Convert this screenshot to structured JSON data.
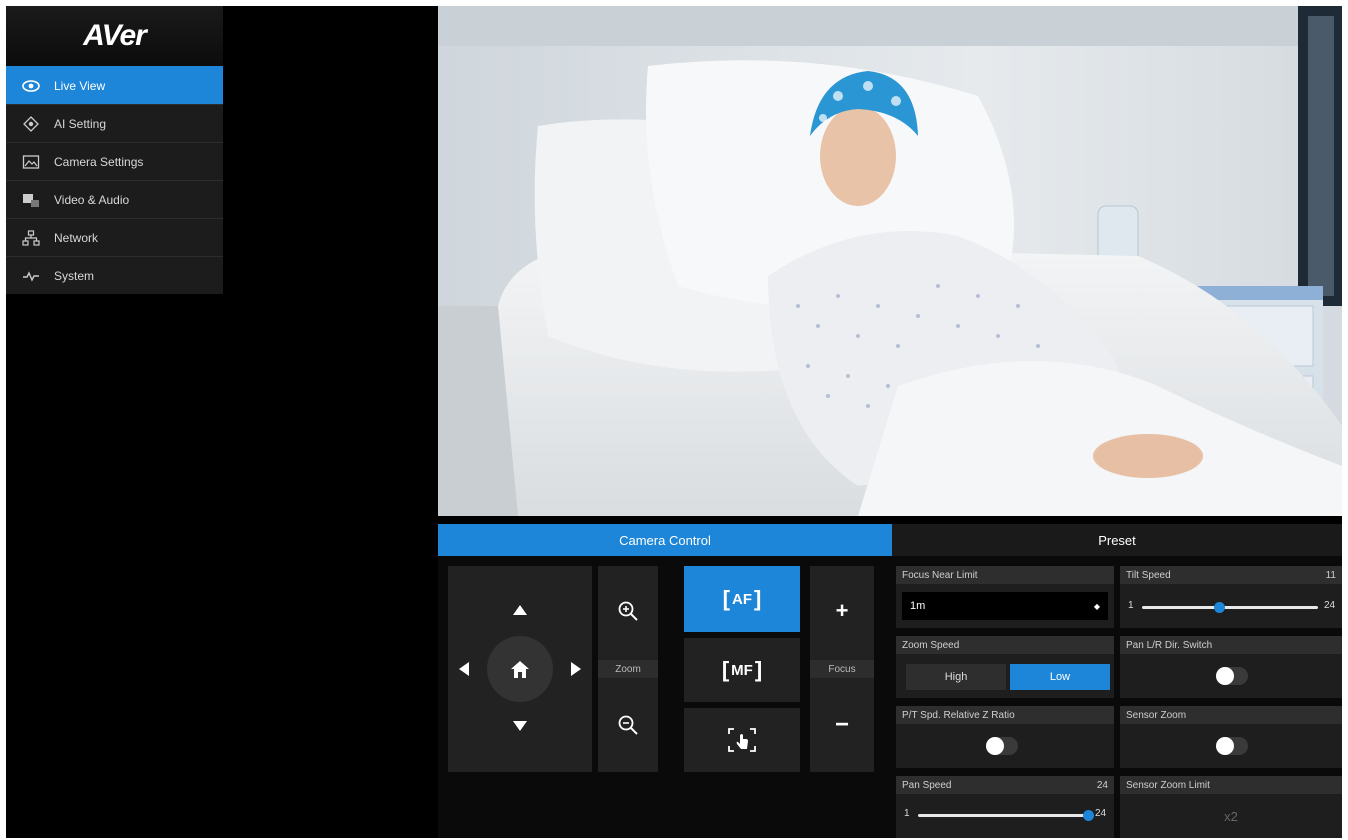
{
  "app": {
    "logo": "AVer"
  },
  "sidebar": {
    "items": [
      {
        "label": "Live View",
        "icon": "eye-icon",
        "active": true
      },
      {
        "label": "AI Setting",
        "icon": "ai-target-icon",
        "active": false
      },
      {
        "label": "Camera Settings",
        "icon": "image-icon",
        "active": false
      },
      {
        "label": "Video & Audio",
        "icon": "video-audio-icon",
        "active": false
      },
      {
        "label": "Network",
        "icon": "network-icon",
        "active": false
      },
      {
        "label": "System",
        "icon": "pulse-icon",
        "active": false
      }
    ]
  },
  "tabs": {
    "camera_control": "Camera Control",
    "preset": "Preset"
  },
  "controls": {
    "zoom_label": "Zoom",
    "focus_label": "Focus",
    "af_label": "AF",
    "mf_label": "MF"
  },
  "settings": {
    "focus_near_limit": {
      "label": "Focus Near Limit",
      "value": "1m"
    },
    "tilt_speed": {
      "label": "Tilt Speed",
      "value": "11",
      "min": "1",
      "max": "24",
      "level": 0.435
    },
    "zoom_speed": {
      "label": "Zoom Speed",
      "options": [
        "High",
        "Low"
      ],
      "selected": "Low"
    },
    "pan_lr_switch": {
      "label": "Pan L/R Dir. Switch",
      "on": false
    },
    "pt_speed_ratio": {
      "label": "P/T Spd. Relative Z Ratio",
      "on": false
    },
    "sensor_zoom": {
      "label": "Sensor Zoom",
      "on": false
    },
    "pan_speed": {
      "label": "Pan Speed",
      "value": "24",
      "min": "1",
      "max": "24",
      "level": 1.0
    },
    "sensor_zoom_limit": {
      "label": "Sensor Zoom Limit",
      "value": "x2"
    }
  },
  "colors": {
    "accent": "#1e86d8",
    "panel": "#222222",
    "background": "#000000"
  }
}
